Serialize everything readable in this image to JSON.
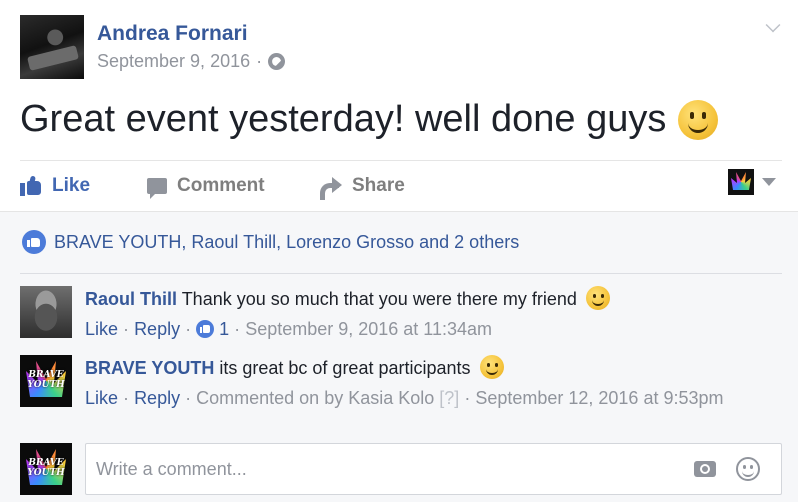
{
  "post": {
    "author_name": "Andrea Fornari",
    "date": "September 9, 2016",
    "separator": "·",
    "privacy_icon": "globe-icon",
    "text": "Great event yesterday! well done guys",
    "emoji": "smile"
  },
  "actions": {
    "like_label": "Like",
    "comment_label": "Comment",
    "share_label": "Share"
  },
  "likes_summary": {
    "text": "BRAVE YOUTH, Raoul Thill, Lorenzo Grosso and 2 others"
  },
  "comments": [
    {
      "author": "Raoul Thill",
      "text": "Thank you so much that you were there my friend",
      "emoji": "smile",
      "like_label": "Like",
      "reply_label": "Reply",
      "like_count": "1",
      "timestamp": "September 9, 2016 at 11:34am",
      "sep": "·"
    },
    {
      "author": "BRAVE YOUTH",
      "text": "its great bc of great participants",
      "emoji": "smile",
      "like_label": "Like",
      "reply_label": "Reply",
      "commented_on_by": "Commented on by Kasia Kolo",
      "bracket_label": "[?]",
      "timestamp": "September 12, 2016 at 9:53pm",
      "sep": "·"
    }
  ],
  "composer": {
    "placeholder": "Write a comment..."
  },
  "colors": {
    "link": "#365899",
    "like_blue": "#4267b2",
    "muted": "#90949c",
    "text": "#1d2129",
    "comments_bg": "#f6f7f9"
  }
}
